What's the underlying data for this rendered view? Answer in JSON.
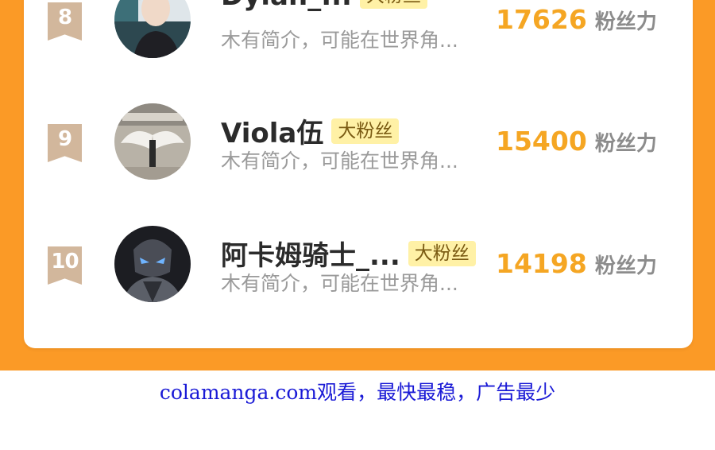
{
  "entries": [
    {
      "rank": "8",
      "name": "Dylan_...",
      "badge": "大粉丝",
      "desc": "木有简介，可能在世界角...",
      "score": "17626",
      "unit": "粉丝力"
    },
    {
      "rank": "9",
      "name": "Viola伍",
      "badge": "大粉丝",
      "desc": "木有简介，可能在世界角...",
      "score": "15400",
      "unit": "粉丝力"
    },
    {
      "rank": "10",
      "name": "阿卡姆骑士_...",
      "badge": "大粉丝",
      "desc": "木有简介，可能在世界角...",
      "score": "14198",
      "unit": "粉丝力"
    }
  ],
  "footer": {
    "text": "colamanga.com观看，最快最稳，广告最少"
  },
  "colors": {
    "background_orange": "#fb9a26",
    "score": "#f5a623",
    "rank_badge": "#d2b79c",
    "badge_bg": "#fff1a6",
    "footer_link": "#1a1ad6"
  }
}
